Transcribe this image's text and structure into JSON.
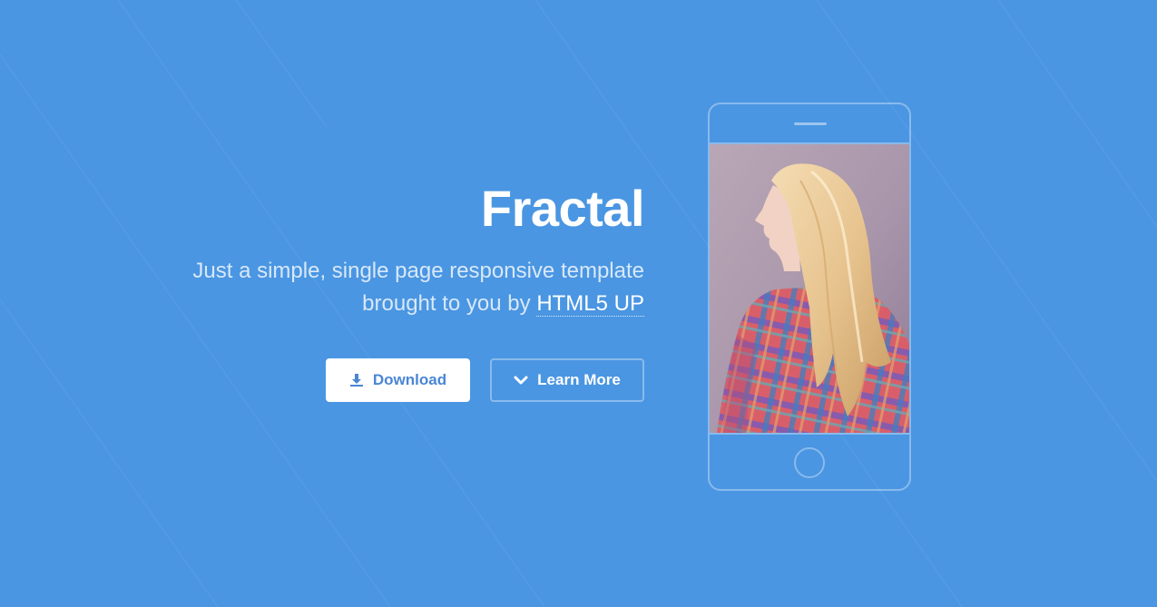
{
  "hero": {
    "title": "Fractal",
    "subtitle_line": "Just a simple, single page responsive template brought to you by",
    "credit_link": "HTML5 UP"
  },
  "actions": {
    "download_label": "Download",
    "learn_more_label": "Learn More"
  },
  "icons": {
    "download": "download-icon",
    "learn_more": "chevron-down-icon"
  },
  "phone": {
    "screen_image": "photo of a blonde woman in a plaid dress, seen in profile"
  },
  "colors": {
    "background": "#4a96e2",
    "button_text": "#4a86d6"
  }
}
